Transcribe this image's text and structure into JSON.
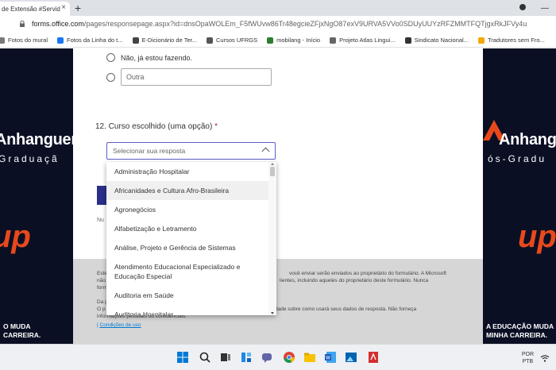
{
  "browser": {
    "tab_title": "de Extensão #Servidor",
    "tab_close": "×",
    "new_tab": "+",
    "url_host": "forms.office.com",
    "url_path": "/pages/responsepage.aspx?id=dnsOpaWOLEm_F5fWUvw86Tr48egcieZFjxNgO87exV9URVA5VVo0SDUyUUYzRFZMMTFQTjgxRkJFVy4u",
    "window_minimize": "—",
    "bookmarks": [
      {
        "label": "Fotos do mural",
        "color": "#7a7a7a"
      },
      {
        "label": "Fotos da Linha do t...",
        "color": "#1877f2"
      },
      {
        "label": "E-Dicionário de Ter...",
        "color": "#444444"
      },
      {
        "label": "Cursos UFRGS",
        "color": "#555555"
      },
      {
        "label": "mobilang - Início",
        "color": "#2e7d32"
      },
      {
        "label": "Projeto Atlas Lingui...",
        "color": "#666666"
      },
      {
        "label": "Sindicato Nacional...",
        "color": "#333333"
      },
      {
        "label": "Tradutores sem Fro...",
        "color": "#f2a900"
      }
    ]
  },
  "form": {
    "option_no": "Não, já estou fazendo.",
    "option_other": "Outra",
    "question_label": "12. Curso escolhido (uma opção)",
    "required_mark": "*",
    "select_placeholder": "Selecionar sua resposta",
    "number_label": "Nu",
    "footer_line1": "Este",
    "footer_line1b": "você enviar serão enviados ao proprietário do formulário. A Microsoft",
    "footer_line2": "não",
    "footer_line2b": "lientes, incluindo aqueles do proprietário deste formulário. Nunca",
    "footer_line3": "form",
    "footer_line4": "Da p",
    "footer_line5": "O p",
    "footer_line5b": "dade sobre como usará seus dados de resposta. Não forneça",
    "footer_line6": "informações pessoais ou confidenciais.",
    "footer_link": "Condições de uso",
    "footer_sep": "|"
  },
  "dropdown": {
    "items": [
      "Administração Hospitalar",
      "Africanidades e Cultura Afro-Brasileira",
      "Agronegócios",
      "Alfabetização e Letramento",
      "Análise, Projeto e Gerência de Sistemas",
      "Atendimento Educacional Especializado e Educação Especial",
      "Auditoria em Saúde",
      "Auditoria Hospitalar"
    ]
  },
  "ads": {
    "brand": "Anhanguera",
    "brand_left_sub": "Graduaçã",
    "brand_right_sub": "ós-Gradu",
    "up": "up",
    "slogan_left_1": "O MUDA",
    "slogan_left_2": "CARREIRA.",
    "slogan_right_1": "A EDUCAÇÃO MUDA",
    "slogan_right_2": "MINHA CARREIRA."
  },
  "taskbar": {
    "lang_top": "POR",
    "lang_bottom": "PTB"
  },
  "colors": {
    "accent": "#5b5fc7",
    "ad_bg": "#0b0f24",
    "ad_orange": "#e8491c",
    "required": "#a4262c"
  }
}
